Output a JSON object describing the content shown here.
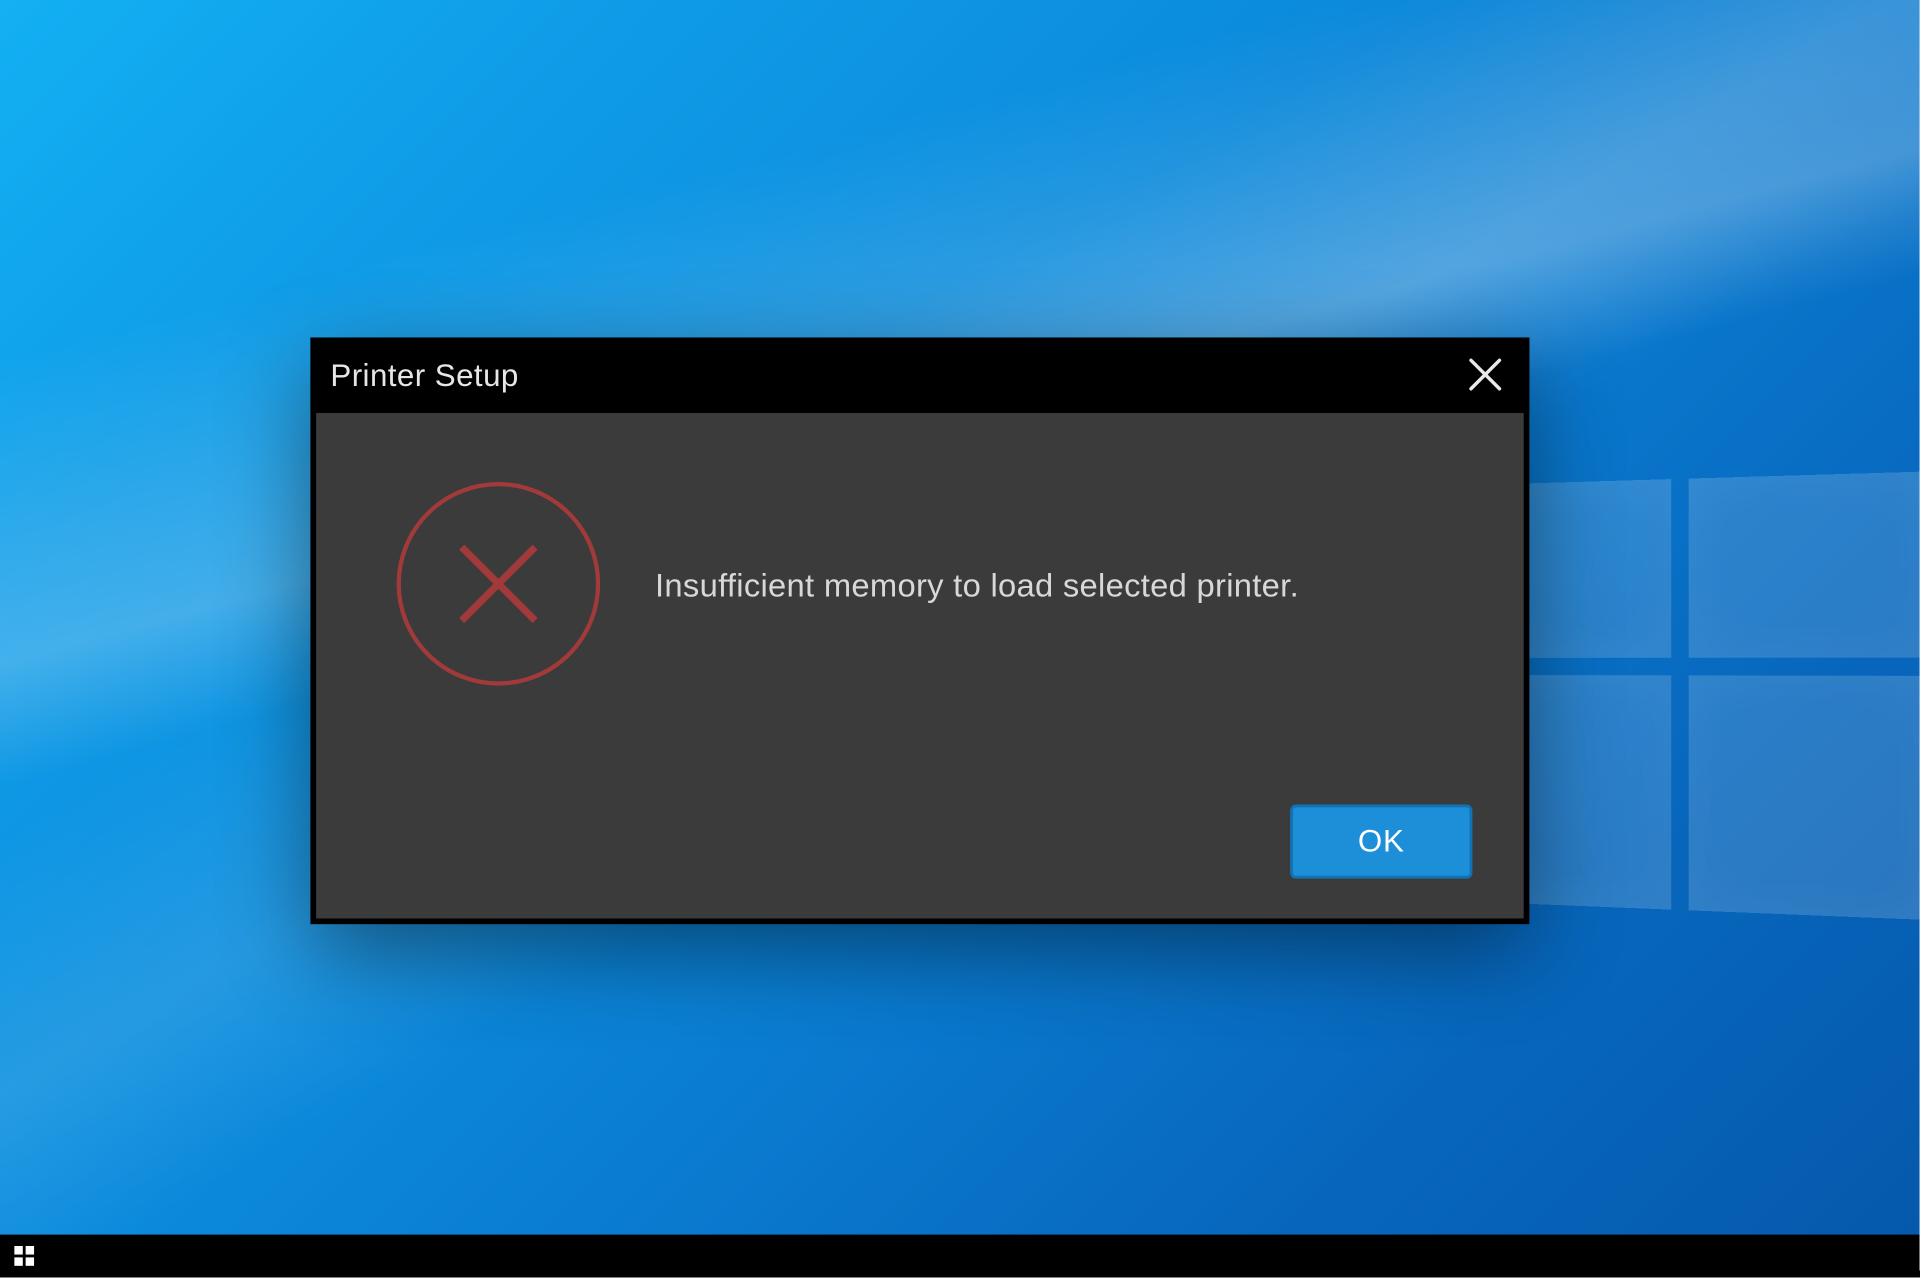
{
  "dialog": {
    "title": "Printer Setup",
    "message": "Insufficient memory to load selected printer.",
    "ok_label": "OK"
  },
  "colors": {
    "dialog_bg": "#3b3b3b",
    "titlebar_bg": "#000000",
    "ok_bg": "#1d8fd8",
    "ok_border": "#1272b3",
    "error_stroke": "#a23a3a"
  }
}
